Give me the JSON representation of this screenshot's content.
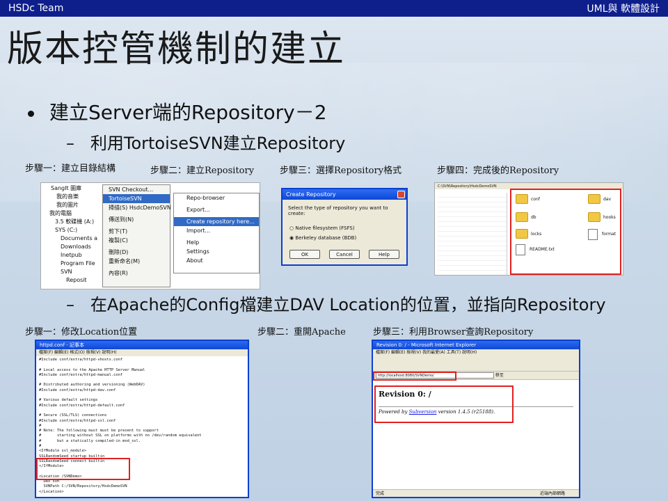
{
  "header": {
    "left": "HSDc Team",
    "right": "UML與 軟體設計"
  },
  "title": "版本控管機制的建立",
  "bullet": "建立Server端的Repository－2",
  "sub1": "利用TortoiseSVN建立Repository",
  "sub2": "在Apache的Config檔建立DAV Location的位置，並指向Repository",
  "steps_row1": [
    "步驟一：建立目錄結構",
    "步驟二：建立Repository",
    "步驟三：選擇Repository格式",
    "步驟四：完成後的Repository"
  ],
  "steps_row2": [
    "步驟一：修改Location位置",
    "步驟二：重開Apache",
    "步驟三：利用Browser查詢Repository"
  ],
  "shot1": {
    "tree": [
      "SangIt 圖庫",
      "我的音樂",
      "我的圖片",
      "我的電腦",
      "3.5 軟碟機 (A:)",
      "SYS (C:)",
      "Documents a",
      "Downloads",
      "Inetpub",
      "Program File",
      "SVN",
      "Reposit"
    ],
    "menu": [
      "SVN Checkout...",
      "TortoiseSVN",
      "掃描(S) HsdcDemoSVN",
      "傳送到(N)",
      "剪下(T)",
      "複製(C)",
      "刪除(D)",
      "重新命名(M)",
      "內容(R)"
    ],
    "submenu": [
      "Repo-browser",
      "Export...",
      "Create repository here...",
      "Import...",
      "Help",
      "Settings",
      "About"
    ]
  },
  "shot2": {
    "title": "Create Repository",
    "prompt": "Select the type of repository you want to create:",
    "options": [
      "Native filesystem (FSFS)",
      "Berkeley database (BDB)"
    ],
    "buttons": [
      "OK",
      "Cancel",
      "Help"
    ]
  },
  "shot3": {
    "path": "C:\\SVN\\Repository\\HsdcDemoSVN",
    "folders": [
      "conf",
      "dav",
      "db",
      "hooks",
      "locks"
    ],
    "files": [
      "README.txt",
      "format"
    ]
  },
  "shot4": {
    "title": "httpd.conf - 記事本",
    "menu": "檔案(F)  編輯(E)  格式(O)  檢視(V)  說明(H)",
    "code": "#Include conf/extra/httpd-vhosts.conf\n\n# Local access to the Apache HTTP Server Manual\n#Include conf/extra/httpd-manual.conf\n\n# Distributed authoring and versioning (WebDAV)\n#Include conf/extra/httpd-dav.conf\n\n# Various default settings\n#Include conf/extra/httpd-default.conf\n\n# Secure (SSL/TLS) connections\n#Include conf/extra/httpd-ssl.conf\n#\n# Note: The following must must be present to support\n#       starting without SSL on platforms with no /dev/random equivalent\n#       but a statically compiled-in mod_ssl.\n#\n<IfModule ssl_module>\nSSLRandomSeed startup builtin\nSSLRandomSeed connect builtin\n</IfModule>\n\n<Location /SVNDemo>\n  DAV svn\n  SVNPath C:/SVN/Repository/HsdcDemoSVN\n</Location>"
  },
  "shot5": {
    "title": "Revision 0: / - Microsoft Internet Explorer",
    "menu": "檔案(F)  編輯(E)  檢視(V)  我的最愛(A)  工具(T)  說明(H)",
    "address": "http://localhost:8080/SVNDemo/",
    "go": "移至",
    "heading": "Revision 0: /",
    "powered_prefix": "Powered by ",
    "powered_link": "Subversion",
    "powered_suffix": " version 1.4.5 (r25188).",
    "status_left": "完成",
    "status_right": "近端內部網路"
  }
}
